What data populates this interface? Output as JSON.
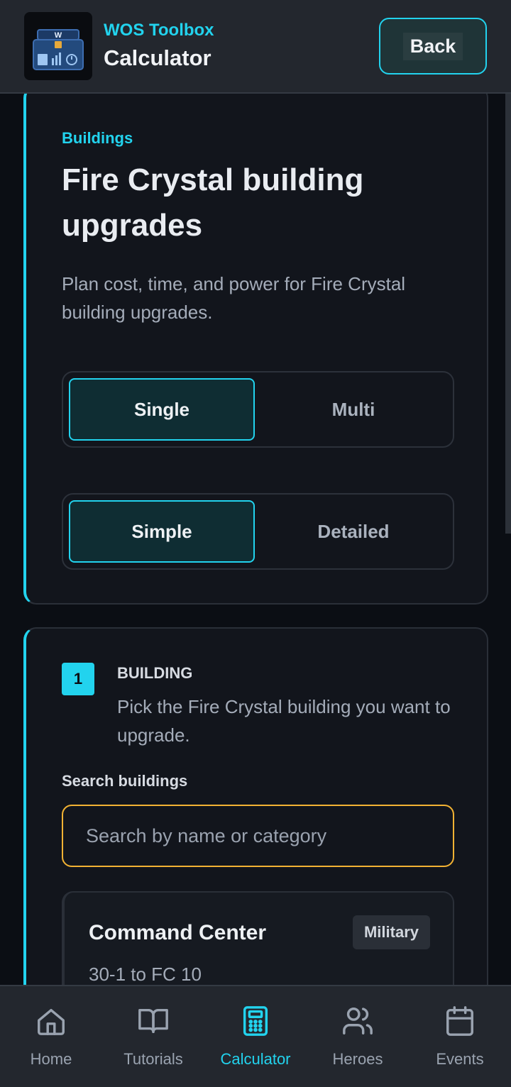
{
  "header": {
    "app_name": "WOS Toolbox",
    "page_title": "Calculator",
    "back_label": "Back",
    "logo_letter": "W"
  },
  "hero": {
    "eyebrow": "Buildings",
    "title": "Fire Crystal building upgrades",
    "description": "Plan cost, time, and power for Fire Crystal building upgrades.",
    "mode_toggle": {
      "options": [
        "Single",
        "Multi"
      ],
      "selected": "Single"
    },
    "view_toggle": {
      "options": [
        "Simple",
        "Detailed"
      ],
      "selected": "Simple"
    }
  },
  "step": {
    "number": "1",
    "label": "BUILDING",
    "description": "Pick the Fire Crystal building you want to upgrade.",
    "search_label": "Search buildings",
    "search_placeholder": "Search by name or category",
    "search_value": ""
  },
  "buildings": [
    {
      "name": "Command Center",
      "category": "Military",
      "range": "30-1 to FC 10"
    }
  ],
  "nav": {
    "items": [
      {
        "label": "Home",
        "icon": "home-icon"
      },
      {
        "label": "Tutorials",
        "icon": "book-icon"
      },
      {
        "label": "Calculator",
        "icon": "calculator-icon"
      },
      {
        "label": "Heroes",
        "icon": "users-icon"
      },
      {
        "label": "Events",
        "icon": "calendar-icon"
      }
    ],
    "active": "Calculator"
  },
  "colors": {
    "accent": "#22d3ee",
    "search_focus": "#f2b233",
    "background": "#0b0e14",
    "card": "#12151c"
  }
}
